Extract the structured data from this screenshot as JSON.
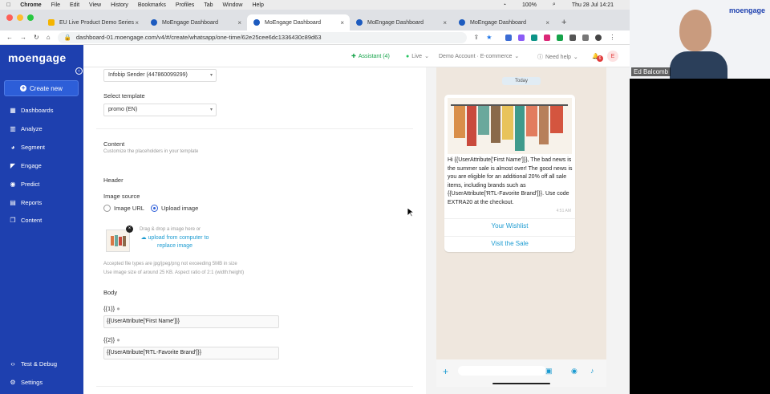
{
  "mac": {
    "menus": [
      "Chrome",
      "File",
      "Edit",
      "View",
      "History",
      "Bookmarks",
      "Profiles",
      "Tab",
      "Window",
      "Help"
    ],
    "battery": "100%",
    "clock": "Thu 28 Jul  14:21"
  },
  "tabs": [
    {
      "label": "EU Live Product Demo Series"
    },
    {
      "label": "MoEngage Dashboard"
    },
    {
      "label": "MoEngage Dashboard"
    },
    {
      "label": "MoEngage Dashboard"
    },
    {
      "label": "MoEngage Dashboard"
    }
  ],
  "url": "dashboard-01.moengage.com/v4/#/create/whatsapp/one-time/62e25cee6dc1336430c89d63",
  "sidebar": {
    "logo": "moengage",
    "create": "Create new",
    "items": [
      "Dashboards",
      "Analyze",
      "Segment",
      "Engage",
      "Predict",
      "Reports",
      "Content"
    ],
    "bottom": [
      "Test & Debug",
      "Settings"
    ]
  },
  "appbar": {
    "assistant": "Assistant (4)",
    "live": "Live",
    "account": "Demo Account · E-commerce",
    "help": "Need help",
    "badge": "6",
    "avatar": "E"
  },
  "form": {
    "sender": "Infobip Sender (447860099299)",
    "template_label": "Select template",
    "template": "promo (EN)",
    "content_title": "Content",
    "content_sub": "Customize the placeholders in your template",
    "header": "Header",
    "image_source": "Image source",
    "opt_url": "Image URL",
    "opt_upload": "Upload image",
    "drag": "Drag & drop a image here or",
    "upload_link": "upload from computer to replace image",
    "hint1": "Accepted file types are jpg/jpeg/png not exceeding 5MB in size",
    "hint2": "Use image size of around 25 KB. Aspect ratio of 2:1 (width:height)",
    "body": "Body",
    "var1": "{{1}}",
    "val1": "{{UserAttribute['First Name']}}",
    "var2": "{{2}}",
    "val2": "{{UserAttribute['RTL-Favorite Brand']}}"
  },
  "preview": {
    "day": "Today",
    "message": "Hi {{UserAttribute['First Name']}}, The bad news is the summer sale is almost over! The good news is you are eligible for an additional 20% off all sale items, including brands such as {{UserAttribute['RTL-Favorite Brand']}}. Use code EXTRA20 at the checkout.",
    "time": "4:51 AM",
    "btn1": "Your Wishlist",
    "btn2": "Visit the Sale"
  },
  "video": {
    "name": "Ed Balcomb",
    "brand": "moengage"
  },
  "colors": {
    "sidebar": "#1e40af",
    "accent": "#2d5ed8",
    "link": "#1b9bd1"
  }
}
